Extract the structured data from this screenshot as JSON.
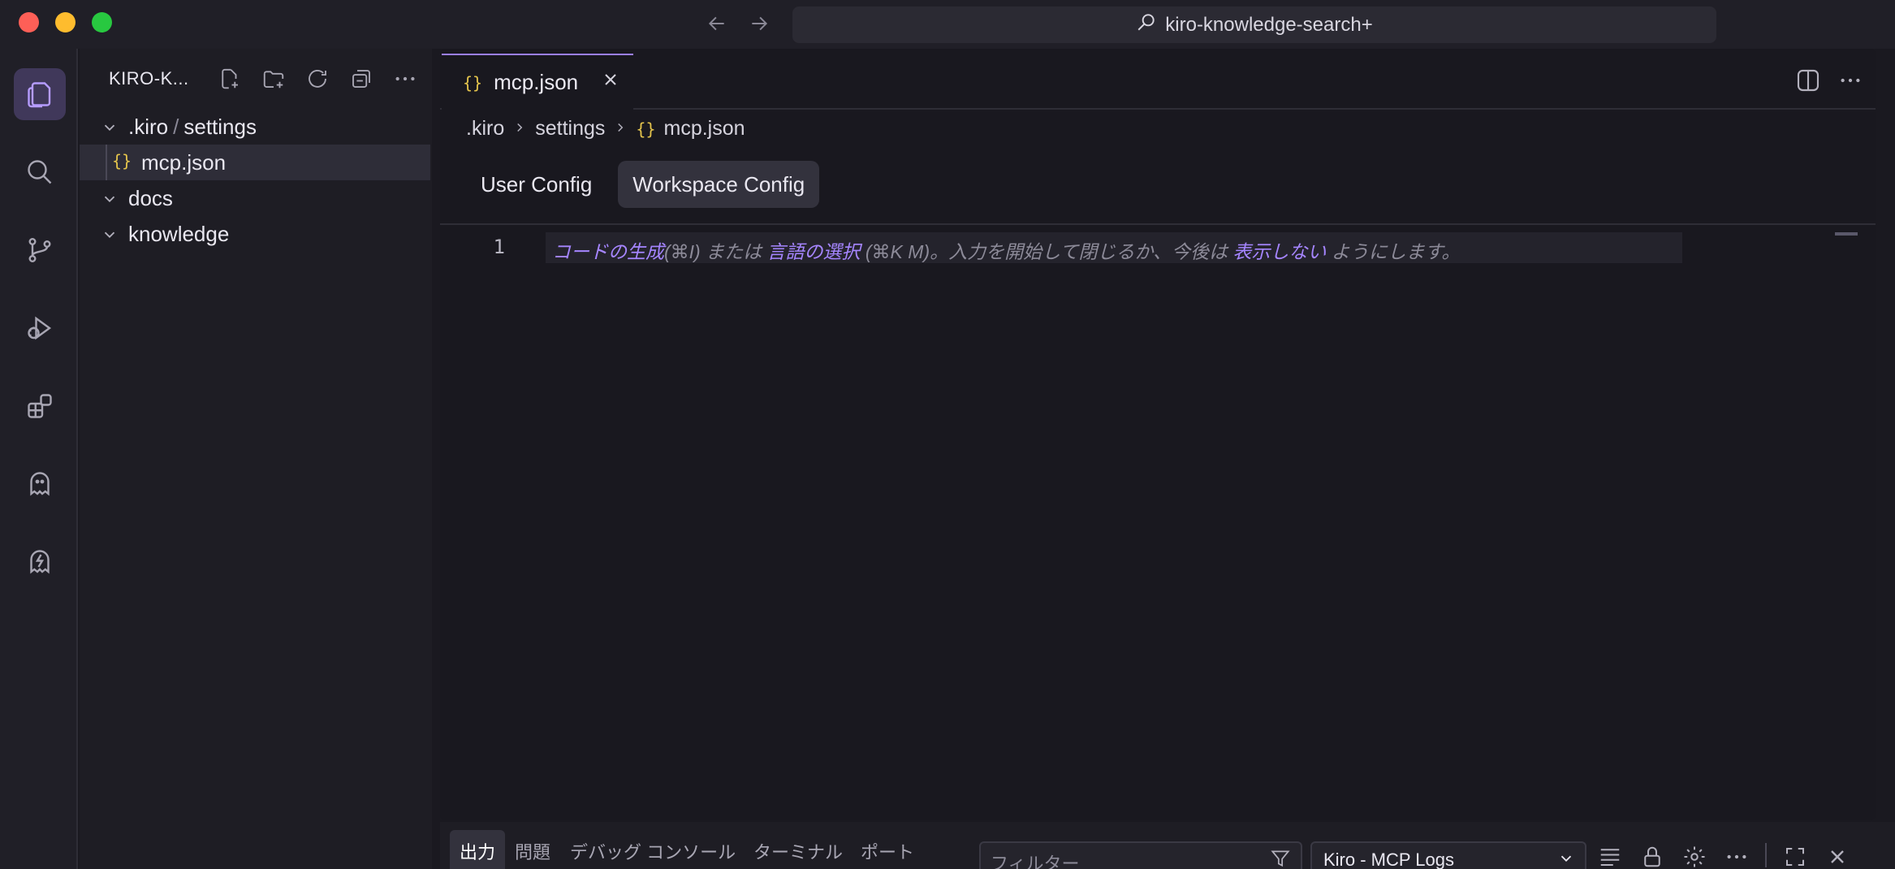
{
  "window": {
    "search_text": "kiro-knowledge-search+"
  },
  "explorer": {
    "title": "KIRO-K...",
    "tree": [
      {
        "type": "folder",
        "label_a": ".kiro",
        "sep": "/",
        "label_b": "settings"
      },
      {
        "type": "file",
        "label": "mcp.json",
        "icon": "{}"
      },
      {
        "type": "folder",
        "label": "docs"
      },
      {
        "type": "folder",
        "label": "knowledge"
      }
    ]
  },
  "editor": {
    "tab": {
      "icon": "{}",
      "label": "mcp.json"
    },
    "breadcrumb": [
      ".kiro",
      "settings",
      "mcp.json"
    ],
    "breadcrumb_icon": "{}",
    "config_tabs": [
      "User Config",
      "Workspace Config"
    ],
    "active_config_tab": "Workspace Config",
    "line_number": "1",
    "hint": {
      "p1": "コードの生成",
      "p2": "(⌘I) または ",
      "p3": "言語の選択",
      "p4": " (⌘K M)。入力を開始して閉じるか、今後は ",
      "p5": "表示しない",
      "p6": " ようにします。"
    }
  },
  "panel": {
    "tabs": [
      "出力",
      "問題",
      "デバッグ コンソール",
      "ターミナル",
      "ポート"
    ],
    "active_tab": "出力",
    "filter_placeholder": "フィルター",
    "log_source": "Kiro - MCP Logs"
  },
  "colors": {
    "accent": "#9b7ff5",
    "json_icon": "#e4c44c",
    "hint_link": "#a585ff"
  }
}
